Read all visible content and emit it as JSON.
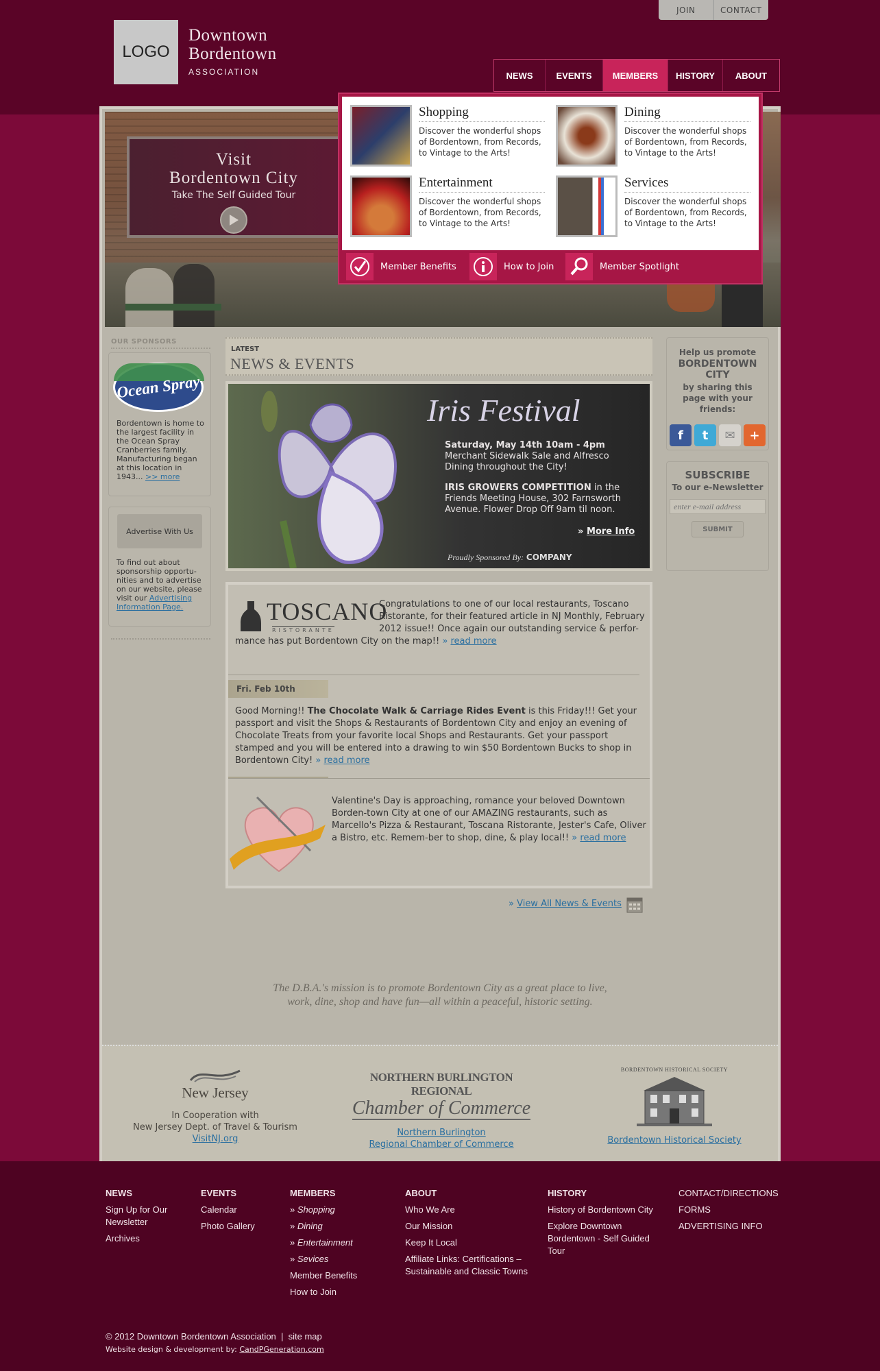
{
  "topbar": {
    "join": "JOIN",
    "contact": "CONTACT"
  },
  "logo": {
    "text": "LOGO"
  },
  "brand": {
    "line1": "Downtown",
    "line2": "Bordentown",
    "line3": "ASSOCIATION"
  },
  "nav": {
    "items": [
      "NEWS",
      "EVENTS",
      "MEMBERS",
      "HISTORY",
      "ABOUT"
    ],
    "active": "MEMBERS"
  },
  "hero": {
    "visit_title": "Visit",
    "visit_title2": "Bordentown City",
    "visit_sub": "Take The Self Guided Tour"
  },
  "mega": {
    "items": [
      {
        "title": "Shopping",
        "desc": "Discover the wonderful shops of Bordentown, from Records, to Vintage to the Arts!"
      },
      {
        "title": "Dining",
        "desc": "Discover the wonderful shops of Bordentown, from Records, to Vintage to the Arts!"
      },
      {
        "title": "Entertainment",
        "desc": "Discover the wonderful shops of Bordentown, from Records, to Vintage to the Arts!"
      },
      {
        "title": "Services",
        "desc": "Discover the wonderful shops of Bordentown, from Records, to Vintage to the Arts!"
      }
    ],
    "footer": [
      "Member Benefits",
      "How to Join",
      "Member Spotlight"
    ]
  },
  "sponsors": {
    "heading": "OUR SPONSORS",
    "ocean_spray_logo": "Ocean Spray",
    "ocean_spray_text": "Bordentown is home to the largest facility in the Ocean Spray Cranberries family. Manufacturing began at this location in 1943...",
    "more_link": ">> more",
    "advertise_button": "Advertise With Us",
    "advertise_text": "To find out about sponsorship opportu-nities and to advertise on our website, please visit our",
    "advertise_link": "Advertising Information Page."
  },
  "news_header": {
    "latest": "LATEST",
    "title": "NEWS & EVENTS"
  },
  "feature": {
    "title": "Iris Festival",
    "date": "Saturday, May 14th 10am - 4pm",
    "line1": "Merchant Sidewalk Sale and Alfresco Dining throughout the City!",
    "comp_bold": "IRIS GROWERS COMPETITION",
    "comp_rest": " in the Friends Meeting House, 302 Farnsworth Avenue. Flower Drop Off 9am til noon.",
    "more": "More Info",
    "sponsored_by": "Proudly Sponsored By:",
    "company": "COMPANY"
  },
  "news": {
    "toscano_logo": "TOSCANO",
    "toscano_sub": "RISTORANTE",
    "toscano_text": "Congratulations to one of our local restaurants, Toscano Ristorante, for their featured article in NJ Monthly, February 2012 issue!! Once again our outstanding service & perfor-mance has put Bordentown City on the map!!",
    "read_more": "read more",
    "date_tag": "Fri. Feb 10th",
    "choc_intro": "Good Morning!! ",
    "choc_bold": "The Chocolate Walk & Carriage Rides Event",
    "choc_rest": " is this Friday!!! Get your passport and visit the Shops & Restaurants of Bordentown City and enjoy an evening of Chocolate Treats from your favorite local Shops and Restaurants. Get your passport stamped and you will be entered into a drawing to win $50 Bordentown Bucks to shop in Bordentown City!",
    "val_text": "Valentine's Day is approaching, romance your beloved Downtown Borden-town City at one of our AMAZING restaurants, such as Marcello's Pizza & Restaurant, Toscana Ristorante, Jester's Cafe, Oliver a Bistro, etc. Remem-ber to shop, dine, & play local!!",
    "view_all": "View All News & Events"
  },
  "share": {
    "l1": "Help us promote",
    "l2": "BORDENTOWN CITY",
    "l3": "by sharing this page with your friends:"
  },
  "subscribe": {
    "title": "SUBSCRIBE",
    "sub": "To our e-Newsletter",
    "placeholder": "enter e-mail address",
    "button": "SUBMIT"
  },
  "mission": {
    "text1": "The D.B.A.'s mission is to promote Bordentown City as a great place to live,",
    "text2": "work, dine, shop and have fun—all within a peaceful, historic setting."
  },
  "partners": {
    "nj_logo": "New Jersey",
    "nj_text1": "In Cooperation with",
    "nj_text2": "New Jersey Dept. of Travel & Tourism",
    "nj_link": "VisitNJ.org",
    "chamber_logo1": "NORTHERN BURLINGTON REGIONAL",
    "chamber_logo2": "Chamber of Commerce",
    "chamber_link1": "Northern Burlington",
    "chamber_link2": "Regional Chamber of Commerce",
    "hist_logo": "BORDENTOWN HISTORICAL SOCIETY",
    "hist_link": "Bordentown Historical Society"
  },
  "footer": {
    "news": {
      "h": "NEWS",
      "items": [
        "Sign Up for Our Newsletter",
        "Archives"
      ]
    },
    "events": {
      "h": "EVENTS",
      "items": [
        "Calendar",
        "Photo Gallery"
      ]
    },
    "members": {
      "h": "MEMBERS",
      "items": [
        "Shopping",
        "Dining",
        "Entertainment",
        "Sevices"
      ],
      "items2": [
        "Member Benefits",
        "How to Join"
      ]
    },
    "about": {
      "h": "ABOUT",
      "items": [
        "Who We Are",
        "Our Mission",
        "Keep It Local",
        "Affiliate Links: Certifications – Sustainable and Classic Towns"
      ]
    },
    "history": {
      "h": "HISTORY",
      "items": [
        "History of Bordentown City",
        "Explore Downtown Bordentown - Self Guided Tour"
      ]
    },
    "misc": {
      "items": [
        "CONTACT/DIRECTIONS",
        "FORMS",
        "ADVERTISING INFO"
      ]
    },
    "copyright": "© 2012 Downtown Bordentown Association",
    "sitemap": "site map",
    "credit": "Website design & development by:",
    "credit_link": "CandPGeneration.com"
  },
  "colors": {
    "header_bg": "#5a0427",
    "body_bg": "#7c0a39",
    "accent": "#c8245a",
    "footer_bg": "#4e0322"
  }
}
